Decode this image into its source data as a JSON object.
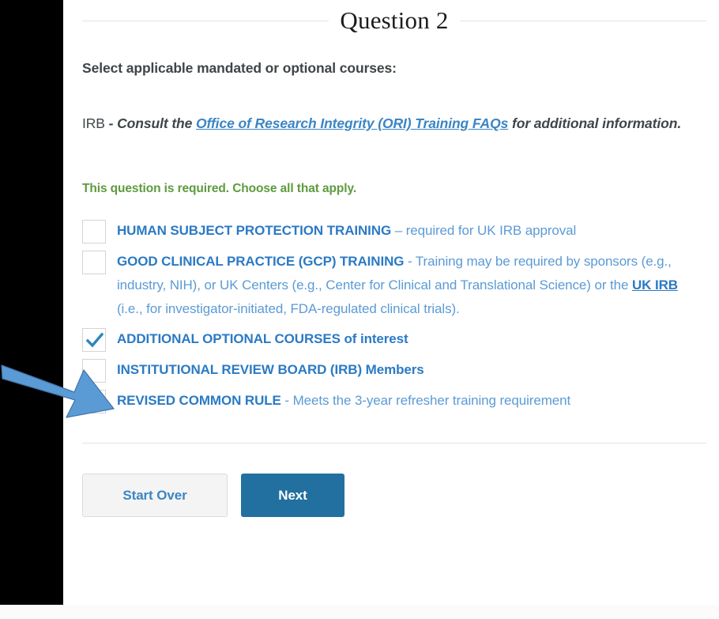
{
  "header": {
    "title": "Question 2"
  },
  "intro": {
    "prompt": "Select applicable mandated or optional courses:",
    "irb_prefix": "IRB",
    "irb_before_link": " - Consult the ",
    "irb_link": "Office of Research Integrity (ORI) Training FAQs",
    "irb_after_link": " for additional information."
  },
  "validation": {
    "message": "This question is required. Choose all that apply."
  },
  "options": [
    {
      "id": "human-subject-protection-training",
      "checked": false,
      "strong": "HUMAN SUBJECT PROTECTION TRAINING",
      "rest": " – required for UK IRB approval"
    },
    {
      "id": "good-clinical-practice-training",
      "checked": false,
      "strong": "GOOD CLINICAL PRACTICE (GCP) TRAINING",
      "rest_1": " - Training may be required by sponsors (e.g., industry, NIH), or UK Centers (e.g., Center for Clinical and Translational Science) or the ",
      "inline_link": "UK IRB",
      "rest_2": " (i.e., for investigator-initiated, FDA-regulated clinical trials)."
    },
    {
      "id": "additional-optional-courses",
      "checked": true,
      "strong": "ADDITIONAL OPTIONAL COURSES of interest",
      "rest": ""
    },
    {
      "id": "irb-members",
      "checked": false,
      "strong": "INSTITUTIONAL REVIEW BOARD (IRB) Members",
      "rest": ""
    },
    {
      "id": "revised-common-rule",
      "checked": false,
      "strong": "REVISED COMMON RULE",
      "rest": " - Meets the 3-year refresher training requirement"
    }
  ],
  "footer": {
    "start_over_label": "Start Over",
    "next_label": "Next"
  },
  "annotation": {
    "arrow_icon": "arrow-right-down-icon",
    "arrow_color": "#5b9bd5",
    "target_option": "additional-optional-courses"
  },
  "colors": {
    "link_blue": "#3b85c4",
    "option_blue": "#5b9bd5",
    "option_bold_blue": "#2b7ac4",
    "required_green": "#5d9b3e",
    "primary_button": "#22709f",
    "text_dark": "#3f4548"
  }
}
